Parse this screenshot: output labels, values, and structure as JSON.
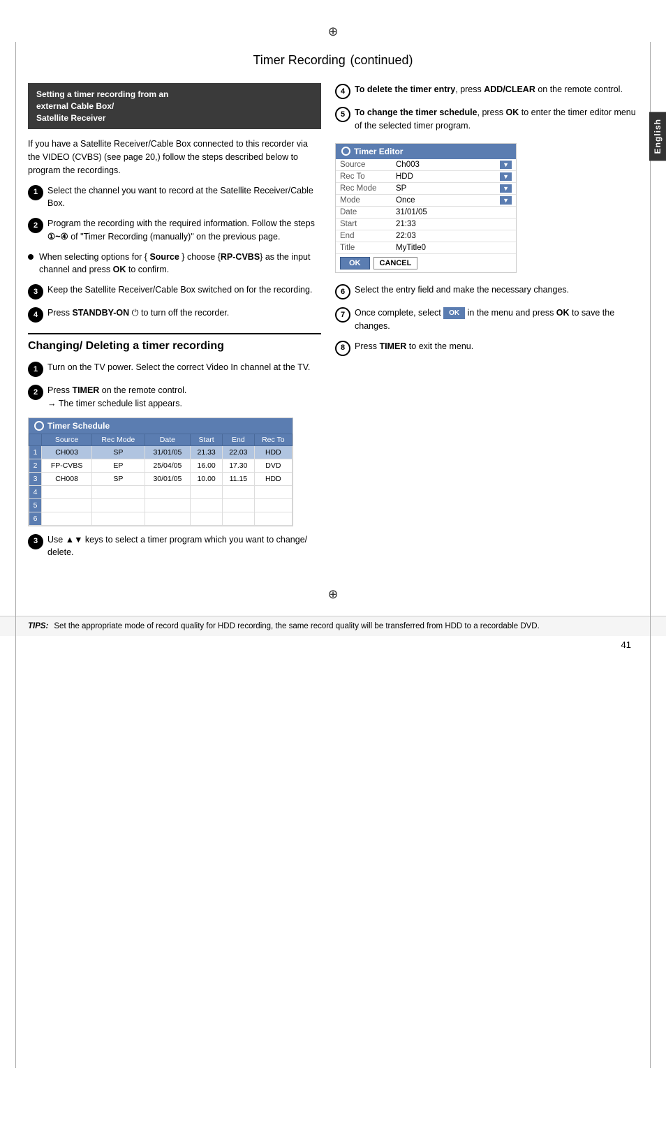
{
  "page": {
    "title": "Timer Recording",
    "title_suffix": "(continued)",
    "page_number": "41",
    "english_tab": "English"
  },
  "left_column": {
    "setting_box": {
      "line1": "Setting a timer recording from an",
      "line2": "external Cable Box/",
      "line3": "Satellite Receiver"
    },
    "intro_para": "If you have a Satellite Receiver/Cable Box connected to this recorder via the VIDEO (CVBS) (see page 20,) follow the steps described below to program the recordings.",
    "steps": [
      {
        "number": "1",
        "text": "Select the channel you want to record at the Satellite Receiver/Cable Box."
      },
      {
        "number": "2",
        "text": "Program the recording with the required information. Follow the steps"
      },
      {
        "number": "3",
        "text": "Keep the Satellite Receiver/Cable Box switched on for the recording."
      },
      {
        "number": "4",
        "text": "Press STANDBY-ON to turn off the recorder."
      }
    ],
    "bullet": {
      "text_start": "When selecting options for {",
      "source_label": "Source",
      "text_mid": "} choose {",
      "rp_cvbs": "RP-CVBS",
      "text_end": "} as the input channel and press",
      "ok_label": "OK",
      "confirm_text": "to confirm."
    },
    "step2_suffix": "~",
    "step2_manual_ref": "of \"Timer Recording (manually)\" on the previous page.",
    "standby_label": "STANDBY-ON",
    "section_divider": true,
    "section": {
      "title": "Changing/ Deleting a timer recording",
      "steps": [
        {
          "number": "1",
          "text": "Turn on the TV power. Select the correct Video In channel at the TV."
        },
        {
          "number": "2",
          "text_before": "Press",
          "bold_word": "TIMER",
          "text_after": "on the remote control.",
          "arrow_text": "The timer schedule list appears."
        },
        {
          "number": "3",
          "text": "Use",
          "keys": "▲▼",
          "text_after": "keys to select a timer program which you want to change/ delete."
        }
      ]
    },
    "timer_schedule": {
      "header": "Timer Schedule",
      "columns": [
        "",
        "Source",
        "Rec Mode",
        "Date",
        "Start",
        "End",
        "Rec To"
      ],
      "rows": [
        {
          "num": "1",
          "source": "CH003",
          "rec_mode": "SP",
          "date": "31/01/05",
          "start": "21.33",
          "end": "22.03",
          "rec_to": "HDD",
          "highlight": true
        },
        {
          "num": "2",
          "source": "FP-CVBS",
          "rec_mode": "EP",
          "date": "25/04/05",
          "start": "16.00",
          "end": "17.30",
          "rec_to": "DVD",
          "highlight": false
        },
        {
          "num": "3",
          "source": "CH008",
          "rec_mode": "SP",
          "date": "30/01/05",
          "start": "10.00",
          "end": "11.15",
          "rec_to": "HDD",
          "highlight": false
        },
        {
          "num": "4",
          "source": "",
          "rec_mode": "",
          "date": "",
          "start": "",
          "end": "",
          "rec_to": "",
          "highlight": false
        },
        {
          "num": "5",
          "source": "",
          "rec_mode": "",
          "date": "",
          "start": "",
          "end": "",
          "rec_to": "",
          "highlight": false
        },
        {
          "num": "6",
          "source": "",
          "rec_mode": "",
          "date": "",
          "start": "",
          "end": "",
          "rec_to": "",
          "highlight": false
        }
      ]
    }
  },
  "right_column": {
    "steps": [
      {
        "number": "4",
        "text_before": "To delete the timer entry",
        "text_after": ", press",
        "bold": "ADD/CLEAR",
        "suffix": "on the remote control."
      },
      {
        "number": "5",
        "text_before": "To change the timer schedule",
        "text_after": ", press",
        "bold": "OK",
        "suffix": "to enter the timer editor menu of the selected timer program."
      },
      {
        "number": "6",
        "text": "Select the entry field and make the necessary changes."
      },
      {
        "number": "7",
        "text_before": "Once complete, select",
        "inline_btn": "OK",
        "text_after": "in the menu and press",
        "bold": "OK",
        "suffix": "to save the changes."
      },
      {
        "number": "8",
        "text_before": "Press",
        "bold": "TIMER",
        "text_after": "to exit the menu."
      }
    ],
    "timer_editor": {
      "header": "Timer Editor",
      "rows": [
        {
          "label": "Source",
          "value": "Ch003",
          "has_dropdown": true
        },
        {
          "label": "Rec To",
          "value": "HDD",
          "has_dropdown": true
        },
        {
          "label": "Rec Mode",
          "value": "SP",
          "has_dropdown": true
        },
        {
          "label": "Mode",
          "value": "Once",
          "has_dropdown": true
        },
        {
          "label": "Date",
          "value": "31/01/05",
          "has_dropdown": false
        },
        {
          "label": "Start",
          "value": "21:33",
          "has_dropdown": false
        },
        {
          "label": "End",
          "value": "22:03",
          "has_dropdown": false
        },
        {
          "label": "Title",
          "value": "MyTitle0",
          "has_dropdown": false
        }
      ],
      "ok_btn": "OK",
      "cancel_btn": "CANCEL"
    }
  },
  "tips": {
    "label": "TIPS:",
    "text": "Set the appropriate mode of record quality for HDD recording, the same record quality will be transferred from HDD to a recordable DVD."
  }
}
